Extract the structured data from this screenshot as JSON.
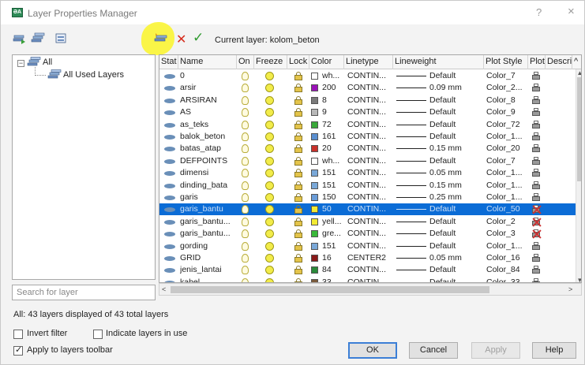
{
  "window": {
    "title": "Layer Properties Manager",
    "help_label": "?",
    "close_label": "×",
    "app_icon_text": "ƏA"
  },
  "toolbar": {
    "current_layer": "Current layer: kolom_beton",
    "delete_symbol": "✕",
    "set_current_symbol": "✓",
    "highlight_color": "#f5ef2a"
  },
  "filter_tree": {
    "root_label": "All",
    "child_label": "All Used Layers"
  },
  "search": {
    "placeholder": "Search for layer"
  },
  "columns": [
    "Stat",
    "Name",
    "On",
    "Freeze",
    "Lock",
    "Color",
    "Linetype",
    "Lineweight",
    "Plot Style",
    "Plot",
    "Descri"
  ],
  "scroll_symbols": {
    "up": "▲",
    "down": "▼",
    "left": "<",
    "right": ">",
    "header_up": "^"
  },
  "layers": [
    {
      "name": "0",
      "color": "wh...",
      "swatch": "#ffffff",
      "linetype": "CONTIN...",
      "lineweight": "Default",
      "plot_style": "Color_7"
    },
    {
      "name": "arsir",
      "color": "200",
      "swatch": "#9b12b8",
      "linetype": "CONTIN...",
      "lineweight": "0.09 mm",
      "plot_style": "Color_2..."
    },
    {
      "name": "ARSIRAN",
      "color": "8",
      "swatch": "#7a7a7a",
      "linetype": "CONTIN...",
      "lineweight": "Default",
      "plot_style": "Color_8"
    },
    {
      "name": "AS",
      "color": "9",
      "swatch": "#b8b8b8",
      "linetype": "CONTIN...",
      "lineweight": "Default",
      "plot_style": "Color_9"
    },
    {
      "name": "as_teks",
      "color": "72",
      "swatch": "#3aa83a",
      "linetype": "CONTIN...",
      "lineweight": "Default",
      "plot_style": "Color_72"
    },
    {
      "name": "balok_beton",
      "color": "161",
      "swatch": "#5a8fd0",
      "linetype": "CONTIN...",
      "lineweight": "Default",
      "plot_style": "Color_1..."
    },
    {
      "name": "batas_atap",
      "color": "20",
      "swatch": "#c8302a",
      "linetype": "CONTIN...",
      "lineweight": "0.15 mm",
      "plot_style": "Color_20"
    },
    {
      "name": "DEFPOINTS",
      "color": "wh...",
      "swatch": "#ffffff",
      "linetype": "CONTIN...",
      "lineweight": "Default",
      "plot_style": "Color_7"
    },
    {
      "name": "dimensi",
      "color": "151",
      "swatch": "#7aa8d8",
      "linetype": "CONTIN...",
      "lineweight": "0.05 mm",
      "plot_style": "Color_1..."
    },
    {
      "name": "dinding_bata",
      "color": "151",
      "swatch": "#7aa8d8",
      "linetype": "CONTIN...",
      "lineweight": "0.15 mm",
      "plot_style": "Color_1..."
    },
    {
      "name": "garis",
      "color": "150",
      "swatch": "#6a9cd8",
      "linetype": "CONTIN...",
      "lineweight": "0.25 mm",
      "plot_style": "Color_1..."
    },
    {
      "name": "garis_bantu",
      "color": "50",
      "swatch": "#f2ea32",
      "linetype": "CONTIN...",
      "lineweight": "Default",
      "plot_style": "Color_50",
      "selected": true,
      "noplot": true
    },
    {
      "name": "garis_bantu...",
      "color": "yell...",
      "swatch": "#f2ea32",
      "linetype": "CONTIN...",
      "lineweight": "Default",
      "plot_style": "Color_2",
      "noplot": true
    },
    {
      "name": "garis_bantu...",
      "color": "gre...",
      "swatch": "#3ab83a",
      "linetype": "CONTIN...",
      "lineweight": "Default",
      "plot_style": "Color_3",
      "noplot": true
    },
    {
      "name": "gording",
      "color": "151",
      "swatch": "#7aa8d8",
      "linetype": "CONTIN...",
      "lineweight": "Default",
      "plot_style": "Color_1..."
    },
    {
      "name": "GRID",
      "color": "16",
      "swatch": "#8a1a1a",
      "linetype": "CENTER2",
      "lineweight": "0.05 mm",
      "plot_style": "Color_16"
    },
    {
      "name": "jenis_lantai",
      "color": "84",
      "swatch": "#2a8a3a",
      "linetype": "CONTIN...",
      "lineweight": "Default",
      "plot_style": "Color_84"
    },
    {
      "name": "kabel",
      "color": "33",
      "swatch": "#7a5a3a",
      "linetype": "CONTIN...",
      "lineweight": "Default",
      "plot_style": "Color_33"
    }
  ],
  "status": "All: 43 layers displayed of 43 total layers",
  "options": {
    "invert_filter": {
      "label": "Invert filter",
      "checked": false
    },
    "indicate_in_use": {
      "label": "Indicate layers in use",
      "checked": false
    },
    "apply_toolbar": {
      "label": "Apply to layers toolbar",
      "checked": true
    }
  },
  "buttons": {
    "ok": "OK",
    "cancel": "Cancel",
    "apply": "Apply",
    "help": "Help"
  }
}
